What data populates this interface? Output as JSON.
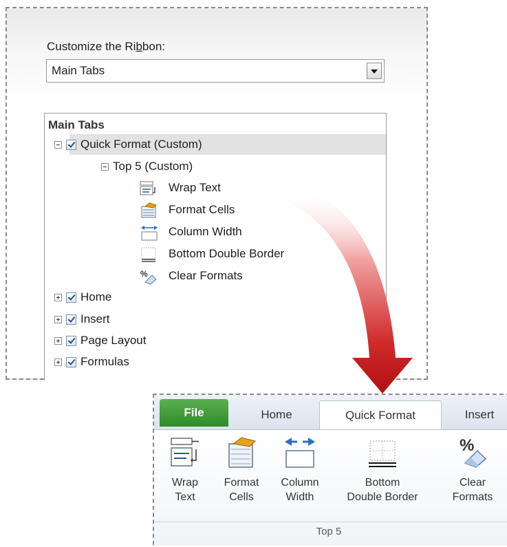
{
  "dialog": {
    "customize_label_pre": "Customize the Ri",
    "customize_label_u": "b",
    "customize_label_post": "bon:",
    "dropdown_value": "Main Tabs"
  },
  "tree": {
    "header": "Main Tabs",
    "quick_format": "Quick Format (Custom)",
    "top5": "Top 5 (Custom)",
    "commands": [
      "Wrap Text",
      "Format Cells",
      "Column Width",
      "Bottom Double Border",
      "Clear Formats"
    ],
    "tabs": [
      "Home",
      "Insert",
      "Page Layout",
      "Formulas"
    ]
  },
  "ribbon": {
    "tabs": [
      "File",
      "Home",
      "Quick Format",
      "Insert"
    ],
    "group_label": "Top 5",
    "buttons": [
      {
        "line1": "Wrap",
        "line2": "Text"
      },
      {
        "line1": "Format",
        "line2": "Cells"
      },
      {
        "line1": "Column",
        "line2": "Width"
      },
      {
        "line1": "Bottom",
        "line2": "Double Border"
      },
      {
        "line1": "Clear",
        "line2": "Formats"
      }
    ]
  },
  "colors": {
    "arrow": "#c8141e",
    "file_tab": "#3a9a30",
    "selected_row": "#e2e2e2"
  }
}
